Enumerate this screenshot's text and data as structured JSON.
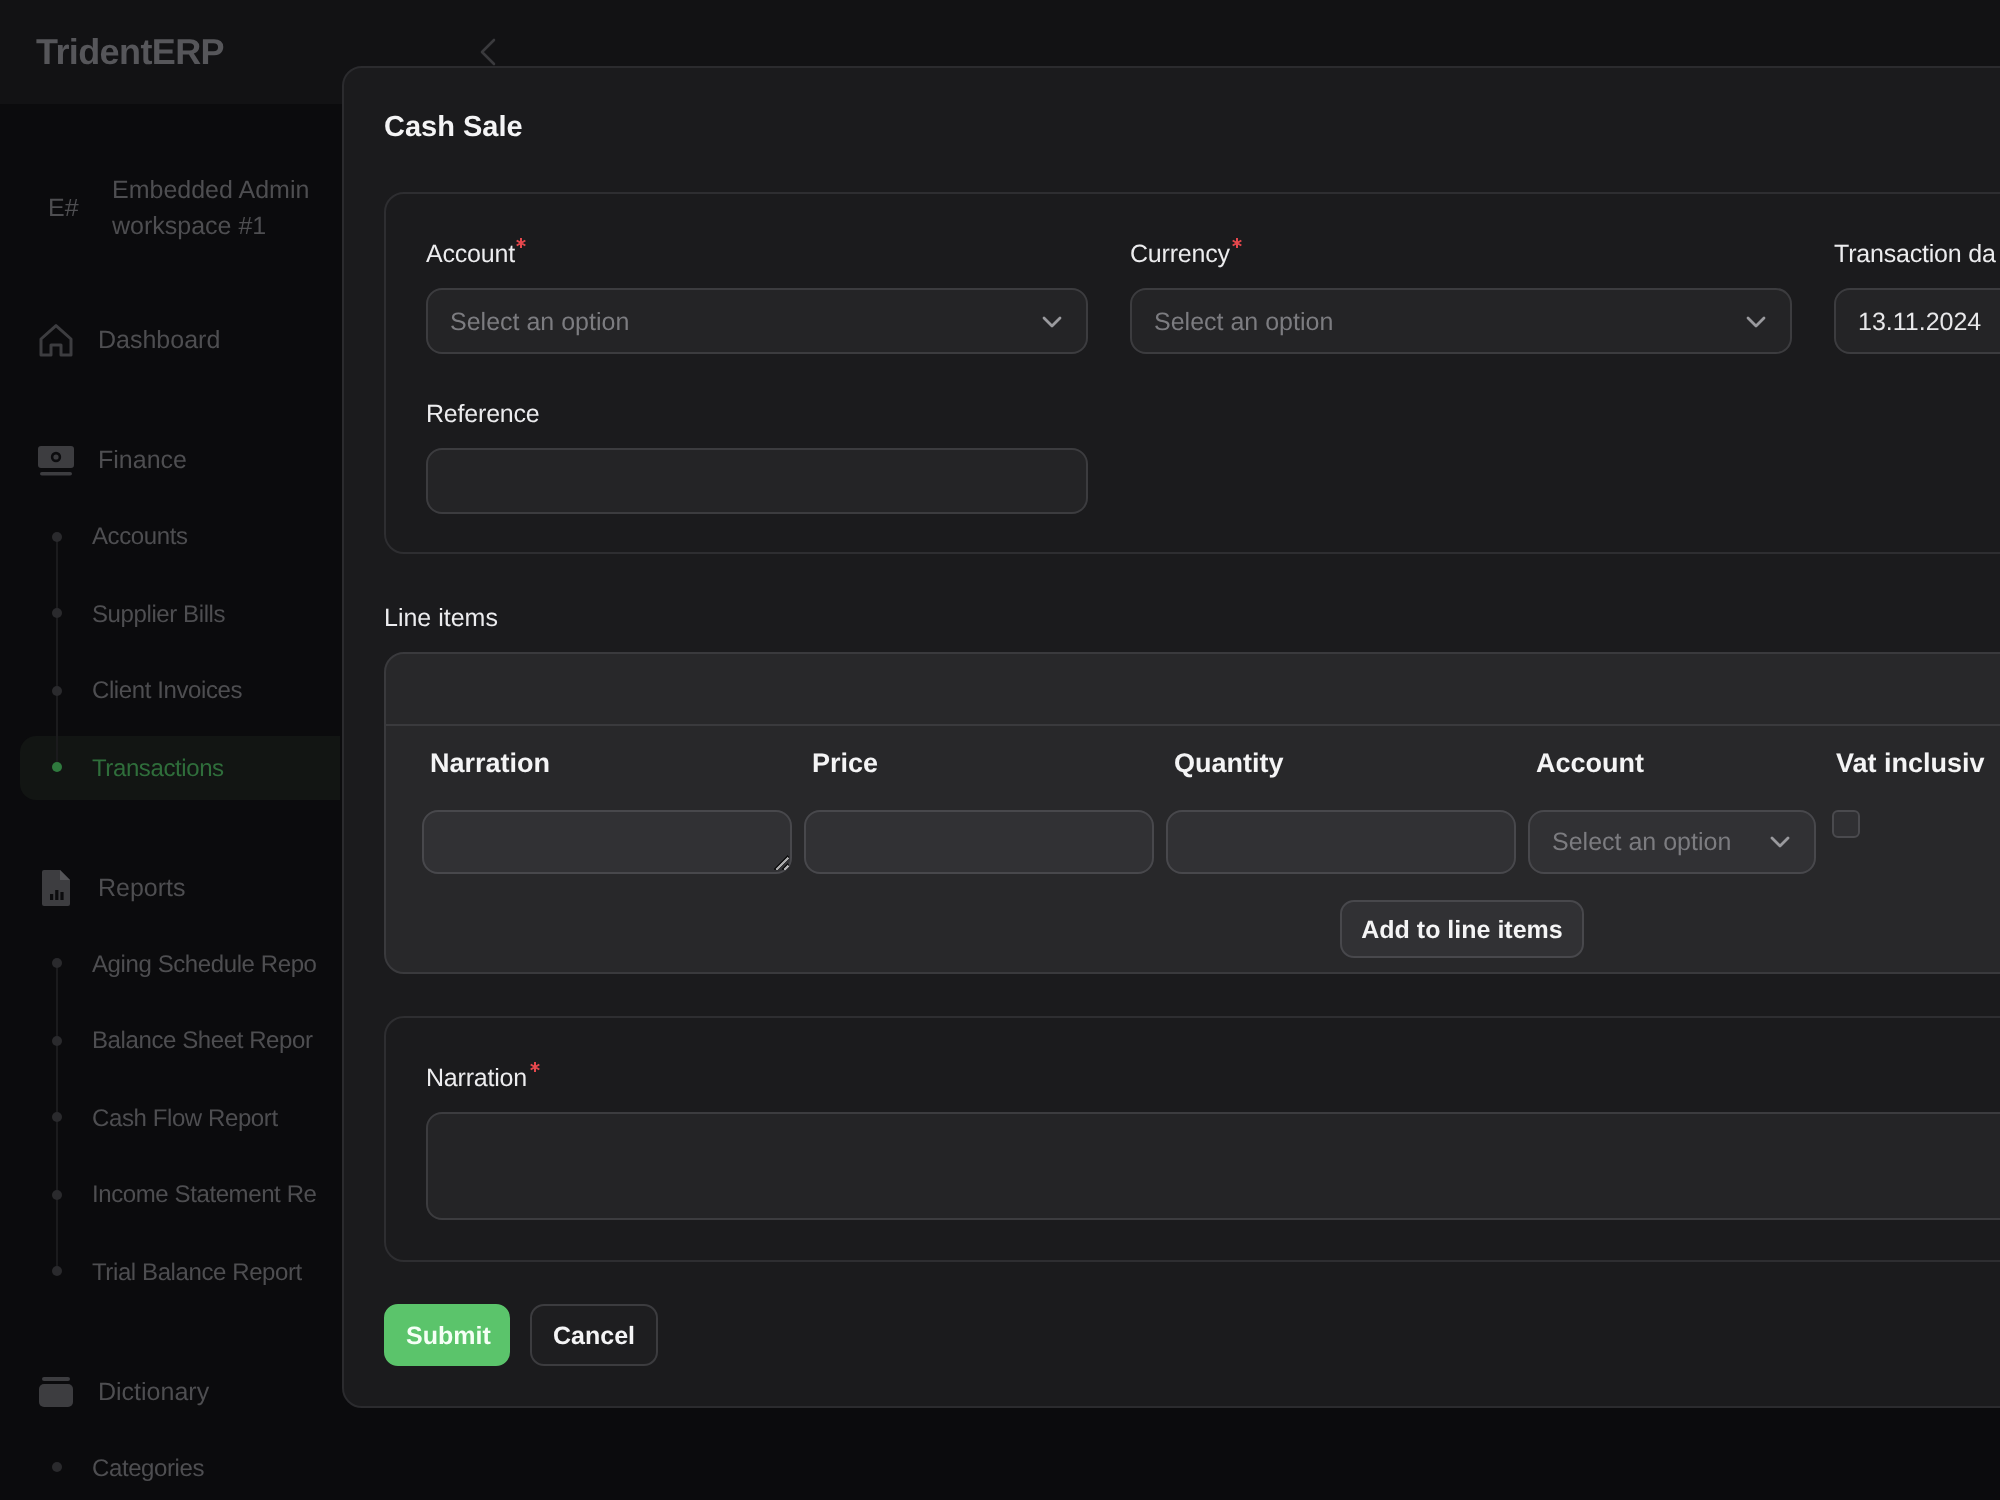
{
  "header": {
    "logo": "TridentERP"
  },
  "workspace": {
    "initials": "E#",
    "name": "Embedded Admin workspace #1"
  },
  "sidebar": {
    "sections": [
      {
        "label": "Dashboard",
        "selected": false
      },
      {
        "label": "Finance",
        "selected": false,
        "children": [
          {
            "label": "Accounts",
            "selected": false
          },
          {
            "label": "Supplier Bills",
            "selected": false
          },
          {
            "label": "Client Invoices",
            "selected": false
          },
          {
            "label": "Transactions",
            "selected": true
          }
        ]
      },
      {
        "label": "Reports",
        "selected": false,
        "children": [
          {
            "label": "Aging Schedule Repo",
            "selected": false
          },
          {
            "label": "Balance Sheet Repor",
            "selected": false
          },
          {
            "label": "Cash Flow Report",
            "selected": false
          },
          {
            "label": "Income Statement Re",
            "selected": false
          },
          {
            "label": "Trial Balance Report",
            "selected": false
          }
        ]
      },
      {
        "label": "Dictionary",
        "selected": false,
        "children": [
          {
            "label": "Categories",
            "selected": false
          }
        ]
      }
    ]
  },
  "dialog": {
    "title": "Cash Sale",
    "fields": [
      {
        "kind": "select",
        "label": "Account",
        "required": true,
        "placeholder": "Select an option"
      },
      {
        "kind": "select",
        "label": "Currency",
        "required": true,
        "placeholder": "Select an option"
      },
      {
        "kind": "date",
        "label": "Transaction da",
        "required": false,
        "value": "13.11.2024"
      },
      {
        "kind": "text",
        "label": "Reference",
        "required": false
      }
    ],
    "line_items": {
      "label": "Line items",
      "columns": [
        "Narration",
        "Price",
        "Quantity",
        "Account",
        "Vat inclusiv"
      ],
      "inputs": [
        {
          "kind": "textarea"
        },
        {
          "kind": "text"
        },
        {
          "kind": "text"
        },
        {
          "kind": "select",
          "placeholder": "Select an option"
        },
        {
          "kind": "checkbox",
          "checked": false
        }
      ],
      "add_button": "Add to line items"
    },
    "narration": {
      "label": "Narration",
      "required": true
    },
    "buttons": [
      {
        "kind": "primary",
        "label": "Submit"
      },
      {
        "kind": "secondary",
        "label": "Cancel"
      }
    ]
  }
}
